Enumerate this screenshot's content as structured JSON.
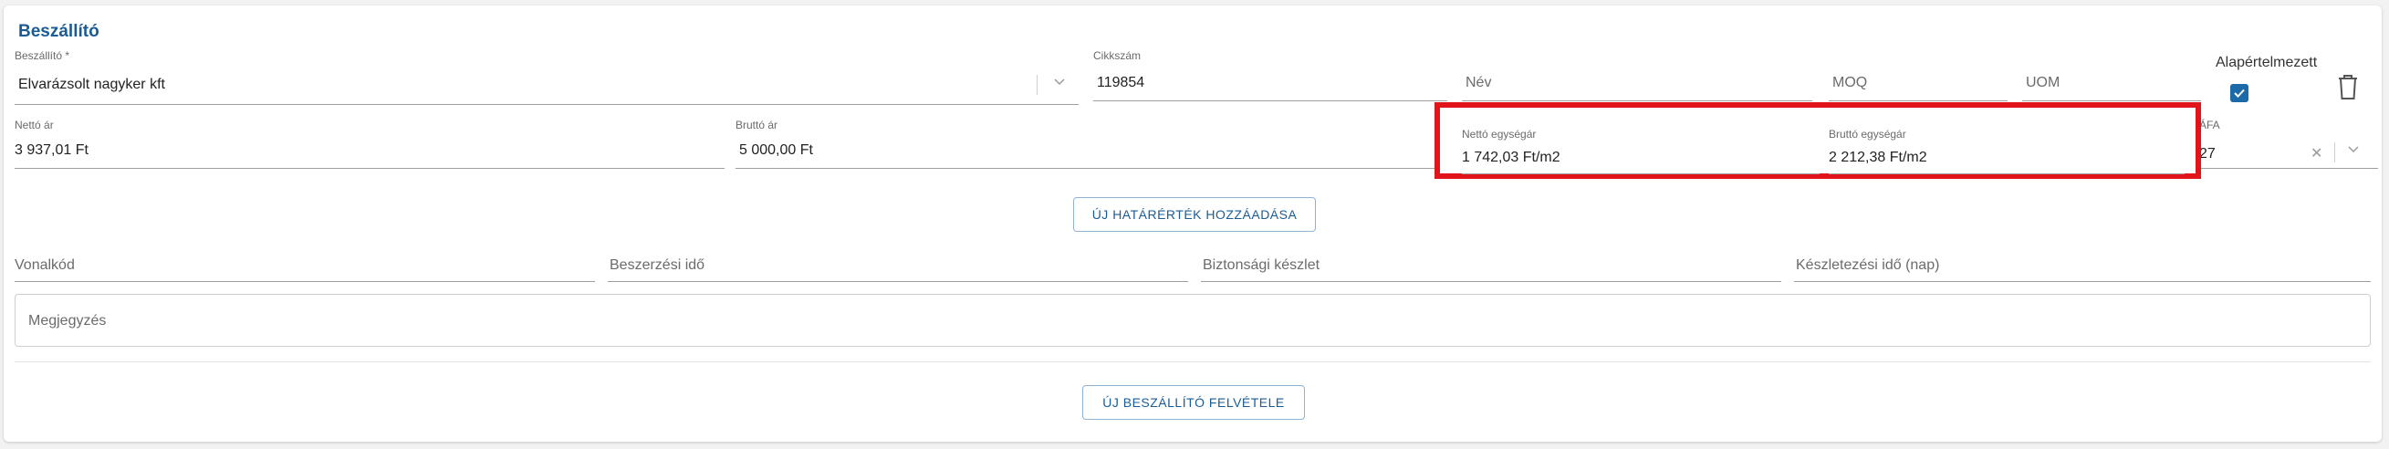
{
  "section": {
    "title": "Beszállító"
  },
  "supplier": {
    "label": "Beszállító *",
    "value": "Elvarázsolt nagyker kft"
  },
  "sku": {
    "label": "Cikkszám",
    "value": "119854"
  },
  "name": {
    "placeholder": "Név"
  },
  "moq": {
    "placeholder": "MOQ"
  },
  "uom": {
    "placeholder": "UOM"
  },
  "default": {
    "label": "Alapértelmezett",
    "checked": true
  },
  "net_price": {
    "label": "Nettó ár",
    "value": "3 937,01 Ft"
  },
  "gross_price": {
    "label": "Bruttó ár",
    "value": "5 000,00 Ft"
  },
  "net_unit_price": {
    "label": "Nettó egységár",
    "value": "1 742,03 Ft/m2"
  },
  "gross_unit_price": {
    "label": "Bruttó egységár",
    "value": "2 212,38 Ft/m2"
  },
  "vat": {
    "label": "ÁFA",
    "value": "27"
  },
  "add_threshold_button": "ÚJ HATÁRÉRTÉK HOZZÁADÁSA",
  "barcode": {
    "placeholder": "Vonalkód"
  },
  "procurement_time": {
    "placeholder": "Beszerzési idő"
  },
  "safety_stock": {
    "placeholder": "Biztonsági készlet"
  },
  "stocking_time": {
    "placeholder": "Készletezési idő (nap)"
  },
  "note": {
    "placeholder": "Megjegyzés"
  },
  "add_supplier_button": "ÚJ BESZÁLLÍTÓ FELVÉTELE",
  "colors": {
    "accent": "#1a5c96",
    "highlight": "#e0151b",
    "checkbox": "#1c6aa8"
  },
  "icons": [
    "chevron-down-icon",
    "trash-icon",
    "clear-icon",
    "checkmark-icon"
  ]
}
